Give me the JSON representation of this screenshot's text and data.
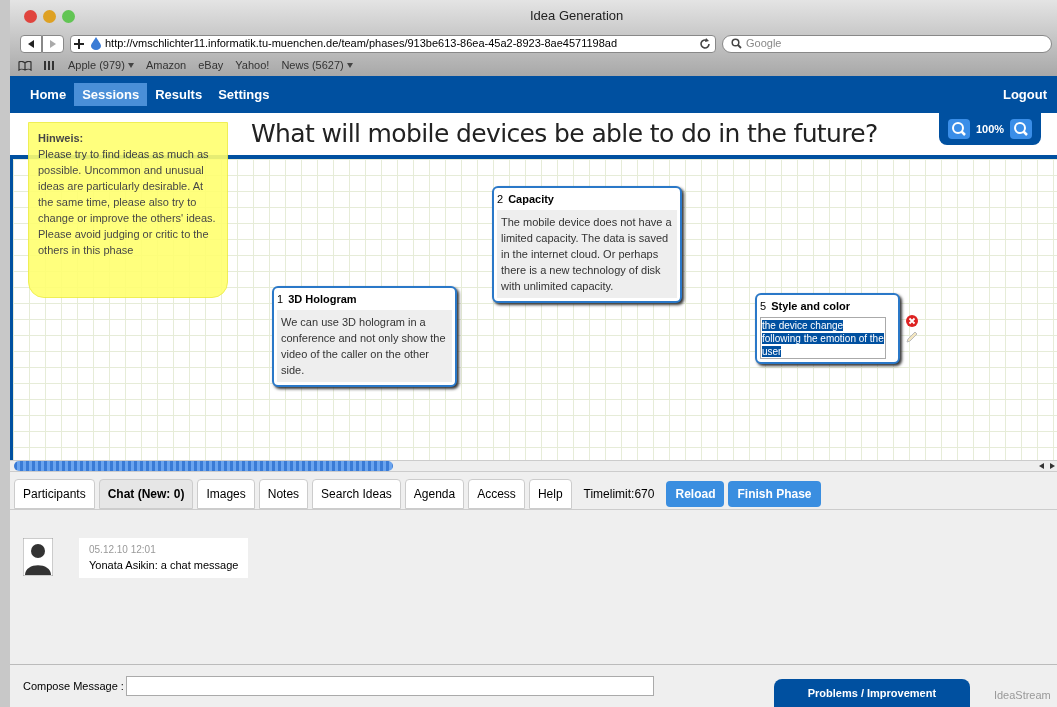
{
  "window": {
    "title": "Idea Generation"
  },
  "address_bar": {
    "url": "http://vmschlichter11.informatik.tu-muenchen.de/team/phases/913be613-86ea-45a2-8923-8ae4571198ad"
  },
  "search": {
    "placeholder": "Google"
  },
  "bookmarks": [
    {
      "label": "Apple (979)",
      "menu": true
    },
    {
      "label": "Amazon",
      "menu": false
    },
    {
      "label": "eBay",
      "menu": false
    },
    {
      "label": "Yahoo!",
      "menu": false
    },
    {
      "label": "News (5627)",
      "menu": true
    }
  ],
  "nav": {
    "items": [
      {
        "label": "Home",
        "selected": false
      },
      {
        "label": "Sessions",
        "selected": true
      },
      {
        "label": "Results",
        "selected": false
      },
      {
        "label": "Settings",
        "selected": false
      }
    ],
    "logout": "Logout"
  },
  "question": "What will mobile devices be able to do in the future?",
  "zoom": {
    "reading": "100%"
  },
  "hint": {
    "title": "Hinweis:",
    "body": "Please try to find ideas as much as possible. Uncommon and unusual ideas are particularly desirable. At the same time, please also try to change or improve the others' ideas. Please avoid judging or critic to the others in this phase"
  },
  "notes": [
    {
      "number": "1",
      "title": "3D Hologram",
      "body": "We can use 3D hologram in a conference and not only show the video of the caller on the other side.",
      "editing": false
    },
    {
      "number": "2",
      "title": "Capacity",
      "body": "The mobile device does not have a limited capacity. The data is saved in the internet cloud. Or perhaps there is a new technology of disk with unlimited capacity.",
      "editing": false
    },
    {
      "number": "5",
      "title": "Style and color",
      "body": "the device change following the emotion of the user",
      "editing": true
    }
  ],
  "scrollbar": {
    "level": 0.37
  },
  "tabs": [
    {
      "label": "Participants",
      "selected": false
    },
    {
      "label": "Chat (New: 0)",
      "selected": true
    },
    {
      "label": "Images",
      "selected": false
    },
    {
      "label": "Notes",
      "selected": false
    },
    {
      "label": "Search Ideas",
      "selected": false
    },
    {
      "label": "Agenda",
      "selected": false
    },
    {
      "label": "Access",
      "selected": false
    },
    {
      "label": "Help",
      "selected": false
    }
  ],
  "timelimit": "Timelimit:670",
  "buttons": [
    "Reload",
    "Finish Phase"
  ],
  "chat": [
    {
      "time": "05.12.10 12:01",
      "text": "Yonata Asikin: a chat message"
    }
  ],
  "compose": {
    "label": "Compose Message :"
  },
  "feedback_button": "Problems / Improvement",
  "footer": "IdeaStream"
}
